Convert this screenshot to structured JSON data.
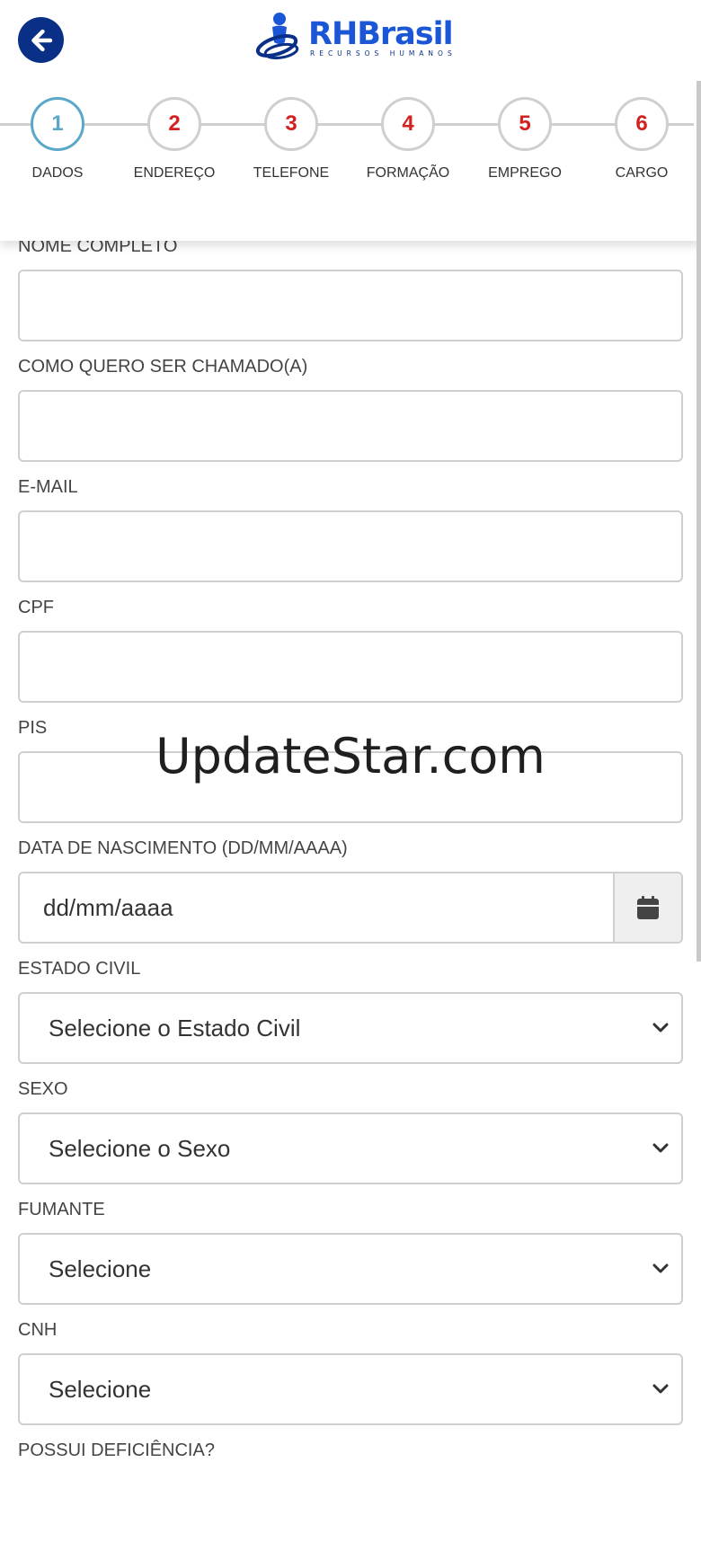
{
  "header": {
    "back_icon": "arrow-left-icon",
    "logo": {
      "name": "RHBrasil",
      "subtitle": "RECURSOS HUMANOS"
    }
  },
  "steps": [
    {
      "number": "1",
      "label": "DADOS",
      "active": true
    },
    {
      "number": "2",
      "label": "ENDEREÇO",
      "active": false
    },
    {
      "number": "3",
      "label": "TELEFONE",
      "active": false
    },
    {
      "number": "4",
      "label": "FORMAÇÃO",
      "active": false
    },
    {
      "number": "5",
      "label": "EMPREGO",
      "active": false
    },
    {
      "number": "6",
      "label": "CARGO",
      "active": false
    }
  ],
  "form": {
    "nome_completo": {
      "label": "NOME COMPLETO",
      "value": ""
    },
    "apelido": {
      "label": "COMO QUERO SER CHAMADO(A)",
      "value": ""
    },
    "email": {
      "label": "E-MAIL",
      "value": ""
    },
    "cpf": {
      "label": "CPF",
      "value": ""
    },
    "pis": {
      "label": "PIS",
      "value": ""
    },
    "nascimento": {
      "label": "DATA DE NASCIMENTO (DD/MM/AAAA)",
      "placeholder": "dd/mm/aaaa",
      "icon": "calendar-icon"
    },
    "estado_civil": {
      "label": "ESTADO CIVIL",
      "selected": "Selecione o Estado Civil"
    },
    "sexo": {
      "label": "SEXO",
      "selected": "Selecione o Sexo"
    },
    "fumante": {
      "label": "FUMANTE",
      "selected": "Selecione"
    },
    "cnh": {
      "label": "CNH",
      "selected": "Selecione"
    },
    "deficiencia": {
      "label": "POSSUI DEFICIÊNCIA?"
    }
  },
  "watermark": "UpdateStar.com",
  "colors": {
    "brand_blue": "#1b56d6",
    "brand_dark": "#0a2f86",
    "step_active": "#5aa7c8",
    "step_number": "#d32020"
  }
}
